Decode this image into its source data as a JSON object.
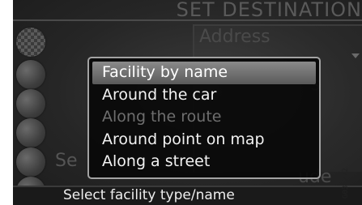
{
  "header": {
    "title": "SET DESTINATION"
  },
  "background": {
    "address_label": "Address",
    "field_fragment": "s",
    "left_fragment": "Se",
    "bottom_fragment": "ude"
  },
  "popup": {
    "items": [
      {
        "label": "Facility by name",
        "state": "selected"
      },
      {
        "label": "Around the car",
        "state": "enabled"
      },
      {
        "label": "Along the route",
        "state": "disabled"
      },
      {
        "label": "Around point on map",
        "state": "enabled"
      },
      {
        "label": "Along a street",
        "state": "enabled"
      }
    ]
  },
  "status_bar": {
    "text": "Select facility type/name"
  },
  "image_code": "G032272",
  "icons": [
    "checkered-flag-icon",
    "menu-icon",
    "menu-icon",
    "menu-icon",
    "menu-icon",
    "menu-icon"
  ],
  "colors": {
    "selection": "#8a8a8a",
    "popup_border": "#a3a3a3",
    "disabled_text": "#6e6e6e"
  }
}
